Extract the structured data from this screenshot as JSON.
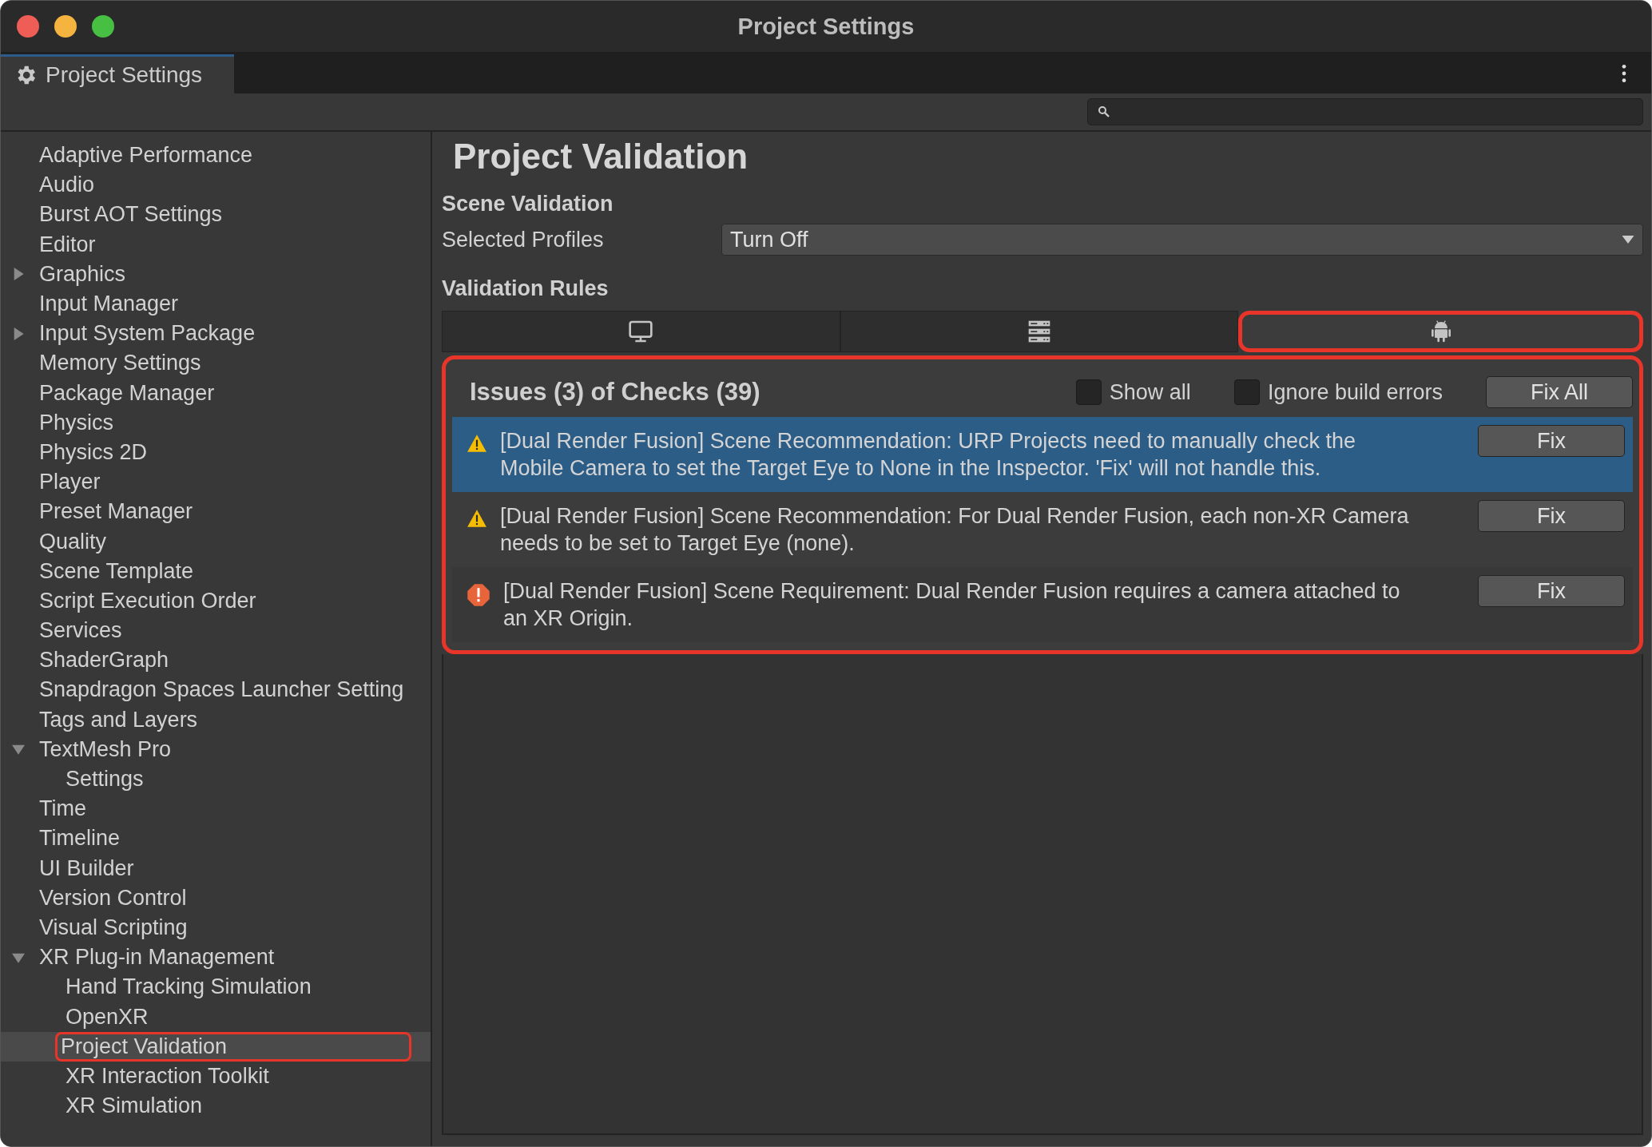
{
  "window": {
    "title": "Project Settings"
  },
  "tab": {
    "label": "Project Settings",
    "selected": true
  },
  "sidebar": {
    "items": [
      {
        "label": "Adaptive Performance",
        "selected": false
      },
      {
        "label": "Audio",
        "selected": false
      },
      {
        "label": "Burst AOT Settings",
        "selected": false
      },
      {
        "label": "Editor",
        "selected": false
      },
      {
        "label": "Graphics",
        "selected": false,
        "expanded": false
      },
      {
        "label": "Input Manager",
        "selected": false
      },
      {
        "label": "Input System Package",
        "selected": false,
        "expanded": false
      },
      {
        "label": "Memory Settings",
        "selected": false
      },
      {
        "label": "Package Manager",
        "selected": false
      },
      {
        "label": "Physics",
        "selected": false
      },
      {
        "label": "Physics 2D",
        "selected": false
      },
      {
        "label": "Player",
        "selected": false
      },
      {
        "label": "Preset Manager",
        "selected": false
      },
      {
        "label": "Quality",
        "selected": false
      },
      {
        "label": "Scene Template",
        "selected": false
      },
      {
        "label": "Script Execution Order",
        "selected": false
      },
      {
        "label": "Services",
        "selected": false
      },
      {
        "label": "ShaderGraph",
        "selected": false
      },
      {
        "label": "Snapdragon Spaces Launcher Setting",
        "selected": false
      },
      {
        "label": "Tags and Layers",
        "selected": false
      },
      {
        "label": "TextMesh Pro",
        "selected": false,
        "expanded": true,
        "children": [
          {
            "label": "Settings",
            "selected": false
          }
        ]
      },
      {
        "label": "Time",
        "selected": false
      },
      {
        "label": "Timeline",
        "selected": false
      },
      {
        "label": "UI Builder",
        "selected": false
      },
      {
        "label": "Version Control",
        "selected": false
      },
      {
        "label": "Visual Scripting",
        "selected": false
      },
      {
        "label": "XR Plug-in Management",
        "selected": false,
        "expanded": true,
        "children": [
          {
            "label": "Hand Tracking Simulation",
            "selected": false
          },
          {
            "label": "OpenXR",
            "selected": false
          },
          {
            "label": "Project Validation",
            "selected": true,
            "highlighted": true
          },
          {
            "label": "XR Interaction Toolkit",
            "selected": false
          },
          {
            "label": "XR Simulation",
            "selected": false
          }
        ]
      }
    ]
  },
  "content": {
    "title": "Project Validation",
    "scene_validation": {
      "heading": "Scene Validation",
      "label": "Selected Profiles",
      "value": "Turn Off"
    },
    "rules_heading": "Validation Rules",
    "platform_tabs": [
      {
        "kind": "monitor",
        "selected": false,
        "highlighted": false
      },
      {
        "kind": "server",
        "selected": false,
        "highlighted": false
      },
      {
        "kind": "android",
        "selected": true,
        "highlighted": true
      }
    ],
    "issues": {
      "highlighted": true,
      "title": "Issues (3) of Checks (39)",
      "checkboxes": [
        {
          "label": "Show all",
          "checked": false
        },
        {
          "label": "Ignore build errors",
          "checked": false
        }
      ],
      "fix_all": "Fix All",
      "rows": [
        {
          "kind": "warning",
          "selected": true,
          "text": "[Dual Render Fusion] Scene Recommendation: URP Projects need to manually check the Mobile Camera to set the Target Eye to None in the Inspector. 'Fix' will not handle this.",
          "button": "Fix"
        },
        {
          "kind": "warning",
          "selected": false,
          "text": "[Dual Render Fusion] Scene Recommendation: For Dual Render Fusion, each non-XR Camera needs to be set to Target Eye (none).",
          "button": "Fix"
        },
        {
          "kind": "error",
          "selected": false,
          "text": "[Dual Render Fusion] Scene Requirement: Dual Render Fusion requires a camera attached to an XR Origin.",
          "button": "Fix"
        }
      ]
    }
  }
}
